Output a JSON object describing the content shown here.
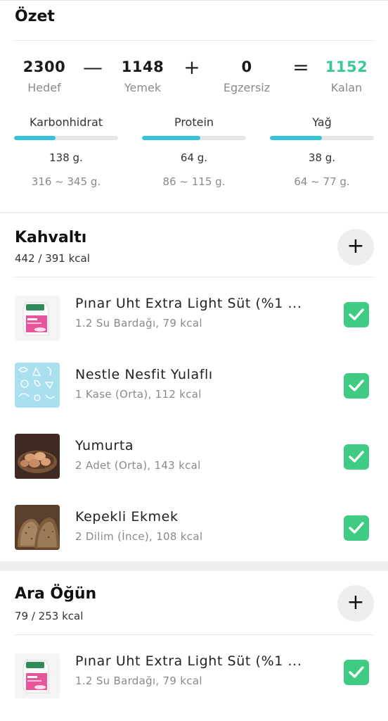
{
  "summary": {
    "title": "Özet",
    "target": {
      "value": "2300",
      "label": "Hedef"
    },
    "food": {
      "value": "1148",
      "label": "Yemek"
    },
    "exercise": {
      "value": "0",
      "label": "Egzersiz"
    },
    "remaining": {
      "value": "1152",
      "label": "Kalan"
    },
    "ops": {
      "minus": "—",
      "plus": "+",
      "equals": "="
    },
    "macros": [
      {
        "name": "Karbonhidrat",
        "value": "138 g.",
        "range": "316 ~ 345 g.",
        "progress": 0.4
      },
      {
        "name": "Protein",
        "value": "64 g.",
        "range": "86 ~ 115 g.",
        "progress": 0.56
      },
      {
        "name": "Yağ",
        "value": "38 g.",
        "range": "64 ~ 77 g.",
        "progress": 0.5
      }
    ]
  },
  "breakfast": {
    "title": "Kahvaltı",
    "kcal": "442 / 391 kcal",
    "items": [
      {
        "name": "Pınar Uht Extra Light Süt (%1 ...",
        "detail": "1.2 Su Bardağı, 79 kcal",
        "checked": true
      },
      {
        "name": "Nestle Nesfit Yulaflı",
        "detail": "1 Kase (Orta), 112 kcal",
        "checked": true
      },
      {
        "name": "Yumurta",
        "detail": "2 Adet (Orta), 143 kcal",
        "checked": true
      },
      {
        "name": "Kepekli Ekmek",
        "detail": "2 Dilim (İnce), 108 kcal",
        "checked": true
      }
    ]
  },
  "snack": {
    "title": "Ara Öğün",
    "kcal": "79 / 253 kcal",
    "items": [
      {
        "name": "Pınar Uht Extra Light Süt (%1 ...",
        "detail": "1.2 Su Bardağı, 79 kcal",
        "checked": true
      }
    ]
  },
  "icons": {
    "add": "plus-icon",
    "check": "checkmark-icon"
  },
  "colors": {
    "accent_green": "#3cc69a",
    "check_green": "#3fcb82",
    "progress": "#33c4d8"
  }
}
